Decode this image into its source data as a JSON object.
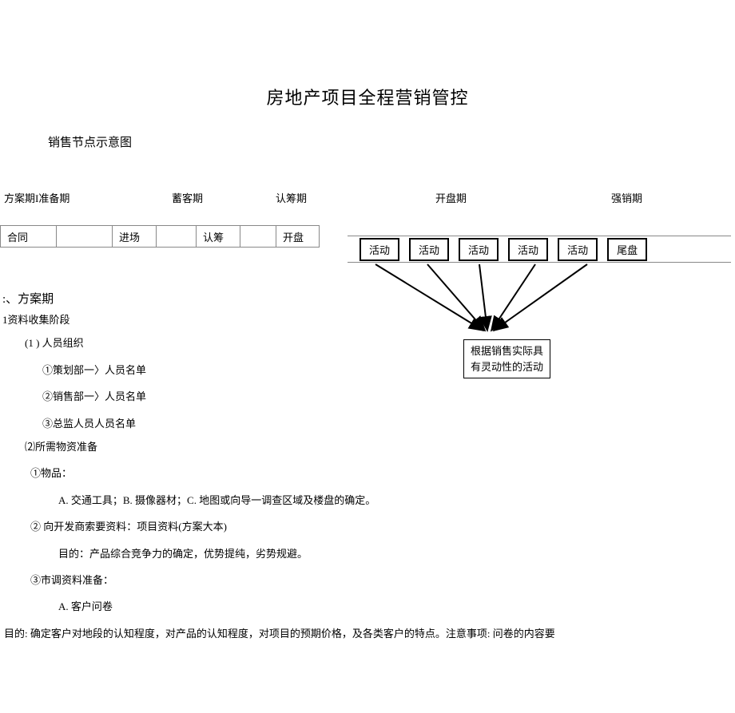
{
  "title": "房地产项目全程营销管控",
  "subtitle": "销售节点示意图",
  "phases": {
    "p1": "方案期I准备期",
    "p2": "蓄客期",
    "p3": "认筹期",
    "p4": "开盘期",
    "p5": "强销期"
  },
  "timeline": {
    "c1": "合同",
    "c2": "进场",
    "c3": "认筹",
    "c4": "开盘"
  },
  "activities": {
    "a1": "活动",
    "a2": "活动",
    "a3": "活动",
    "a4": "活动",
    "a5": "活动",
    "a6": "尾盘"
  },
  "note": {
    "line1": "根据销售实际具",
    "line2": "有灵动性的活动"
  },
  "content": {
    "section_header": ":、方案期",
    "sub1": "1资料收集阶段",
    "item1": "(1 ) 人员组织",
    "item1_1": "①策划部一〉人员名单",
    "item1_2": "②销售部一〉人员名单",
    "item1_3": "③总监人员人员名单",
    "item2": "⑵所需物资准备",
    "item2_1": "①物品：",
    "item2_1_a": "A. 交通工具；B. 摄像器材；C. 地图或向导一调查区域及楼盘的确定。",
    "item2_2": "② 向开发商索要资料：项目资料(方案大本)",
    "item2_2_a": "目的：产品综合竞争力的确定，优势提纯，劣势规避。",
    "item2_3": "③市调资料准备：",
    "item2_3_a": "A. 客户问卷",
    "bottom": "目的: 确定客户对地段的认知程度，对产品的认知程度，对项目的预期价格，及各类客户的特点。注意事项: 问卷的内容要"
  }
}
